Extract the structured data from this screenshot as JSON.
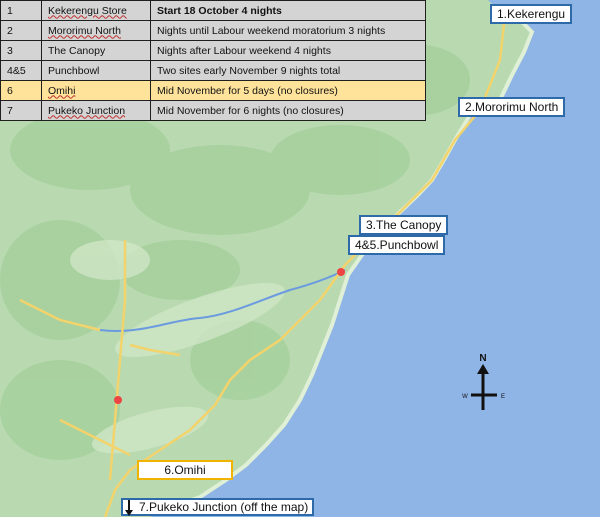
{
  "map": {
    "colors": {
      "sea": "#8fb4e6",
      "land": "#b9d9b0",
      "hills": "#9ccc93",
      "road": "#f3d36b",
      "river": "#6a9be0",
      "coast": "#dff0d6"
    },
    "place_names": [
      "Kekerengu",
      "Mororimu North",
      "The Canopy",
      "Punchbowl",
      "Omihi",
      "Pukeko Junction"
    ]
  },
  "schedule": {
    "rows": [
      {
        "num": "1",
        "place": "Kekerengu Store",
        "note": "Start 18 October 4 nights",
        "highlight": false
      },
      {
        "num": "2",
        "place": "Mororimu North",
        "note": "Nights until Labour weekend moratorium 3 nights",
        "highlight": false
      },
      {
        "num": "3",
        "place": "The Canopy",
        "note": "Nights after Labour weekend 4 nights",
        "highlight": false
      },
      {
        "num": "4&5",
        "place": "Punchbowl",
        "note": "Two sites early November 9 nights total",
        "highlight": false
      },
      {
        "num": "6",
        "place": "Omihi",
        "note": "Mid November for 5 days (no closures)",
        "highlight": true
      },
      {
        "num": "7",
        "place": "Pukeko Junction",
        "note": "Mid November for 6 nights (no closures)",
        "highlight": false
      }
    ]
  },
  "labels": {
    "kekerengu": "1.Kekerengu",
    "mororimu": "2.Mororimu North",
    "canopy": "3.The Canopy",
    "punchbowl": "4&5.Punchbowl",
    "omihi": "6.Omihi",
    "pukeko": "7.Pukeko Junction (off the map)"
  },
  "compass": {
    "n": "N",
    "w": "W",
    "e": "E"
  }
}
